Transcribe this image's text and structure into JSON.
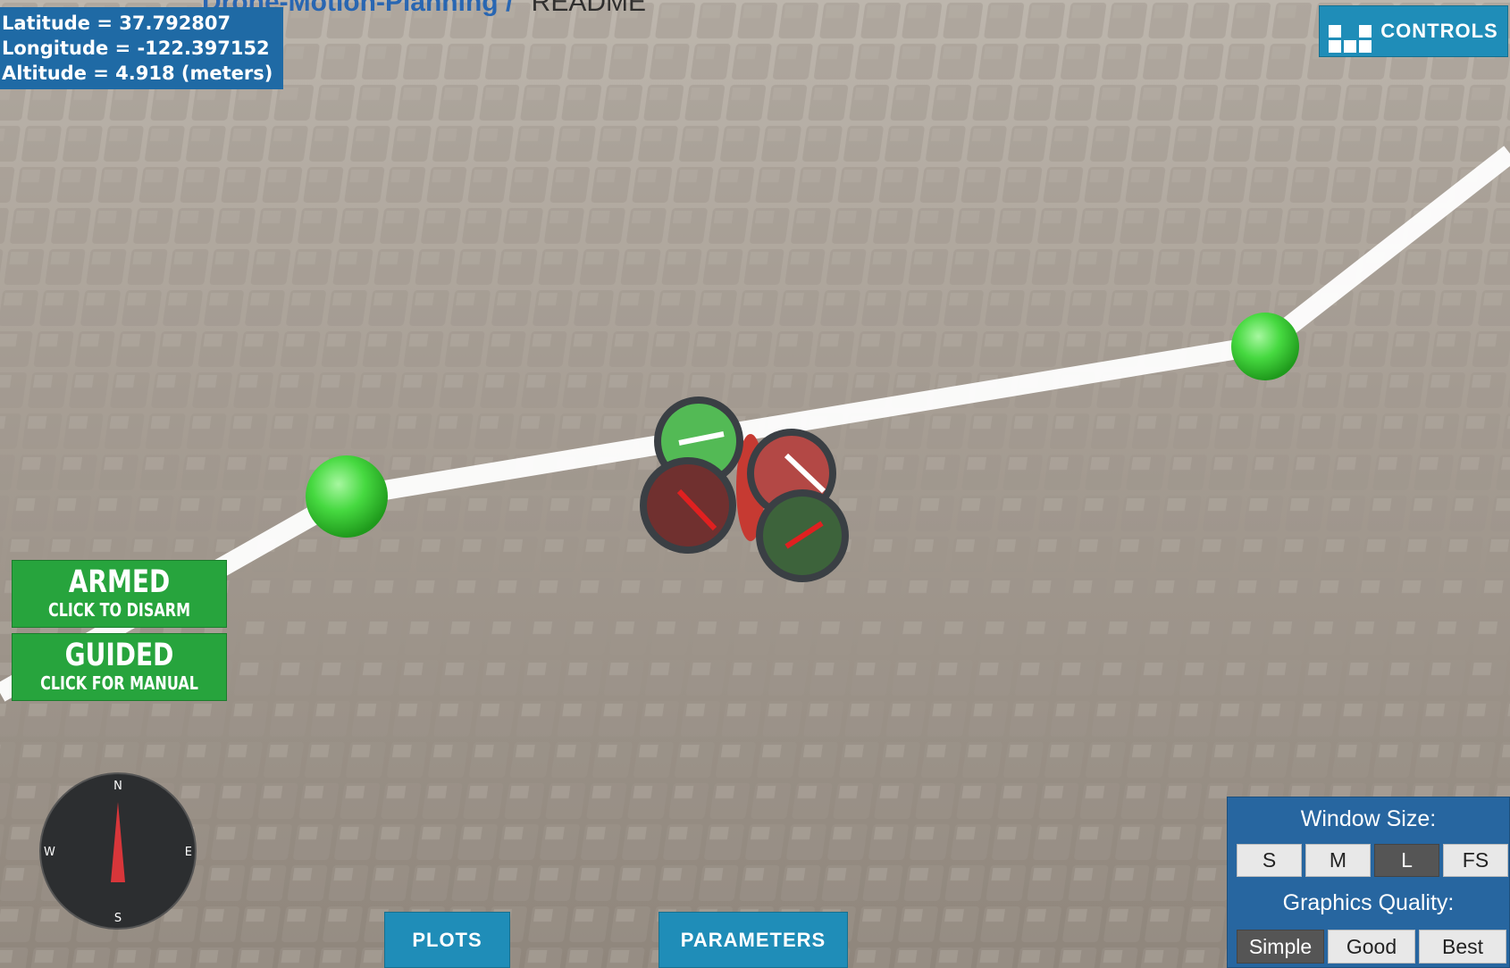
{
  "browser": {
    "repo_link": "Drone-Motion-Planning",
    "separator": "/",
    "file_tab": "README"
  },
  "telemetry": {
    "latitude": "Latitude = 37.792807",
    "longitude": "Longitude = -122.397152",
    "altitude": "Altitude = 4.918 (meters)"
  },
  "controls_button": {
    "label": "CONTROLS",
    "icon": "grid-icon"
  },
  "arm_button": {
    "label": "ARMED",
    "sublabel": "CLICK TO DISARM",
    "color": "#27a43d"
  },
  "mode_button": {
    "label": "GUIDED",
    "sublabel": "CLICK FOR MANUAL",
    "color": "#27a43d"
  },
  "compass": {
    "north": "N",
    "south": "S",
    "east": "E",
    "west": "W",
    "heading_deg": 0
  },
  "bottom_buttons": {
    "plots": "PLOTS",
    "parameters": "PARAMETERS"
  },
  "settings_panel": {
    "window_size_title": "Window Size:",
    "window_sizes": [
      "S",
      "M",
      "L",
      "FS"
    ],
    "window_size_selected": "L",
    "graphics_title": "Graphics Quality:",
    "graphics_options": [
      "Simple",
      "Good",
      "Best"
    ],
    "graphics_selected": "Simple"
  },
  "colors": {
    "accent_blue": "#1f8db8",
    "panel_blue": "#2766a0",
    "waypoint_green": "#4cd64c",
    "armed_green": "#27a43d"
  }
}
